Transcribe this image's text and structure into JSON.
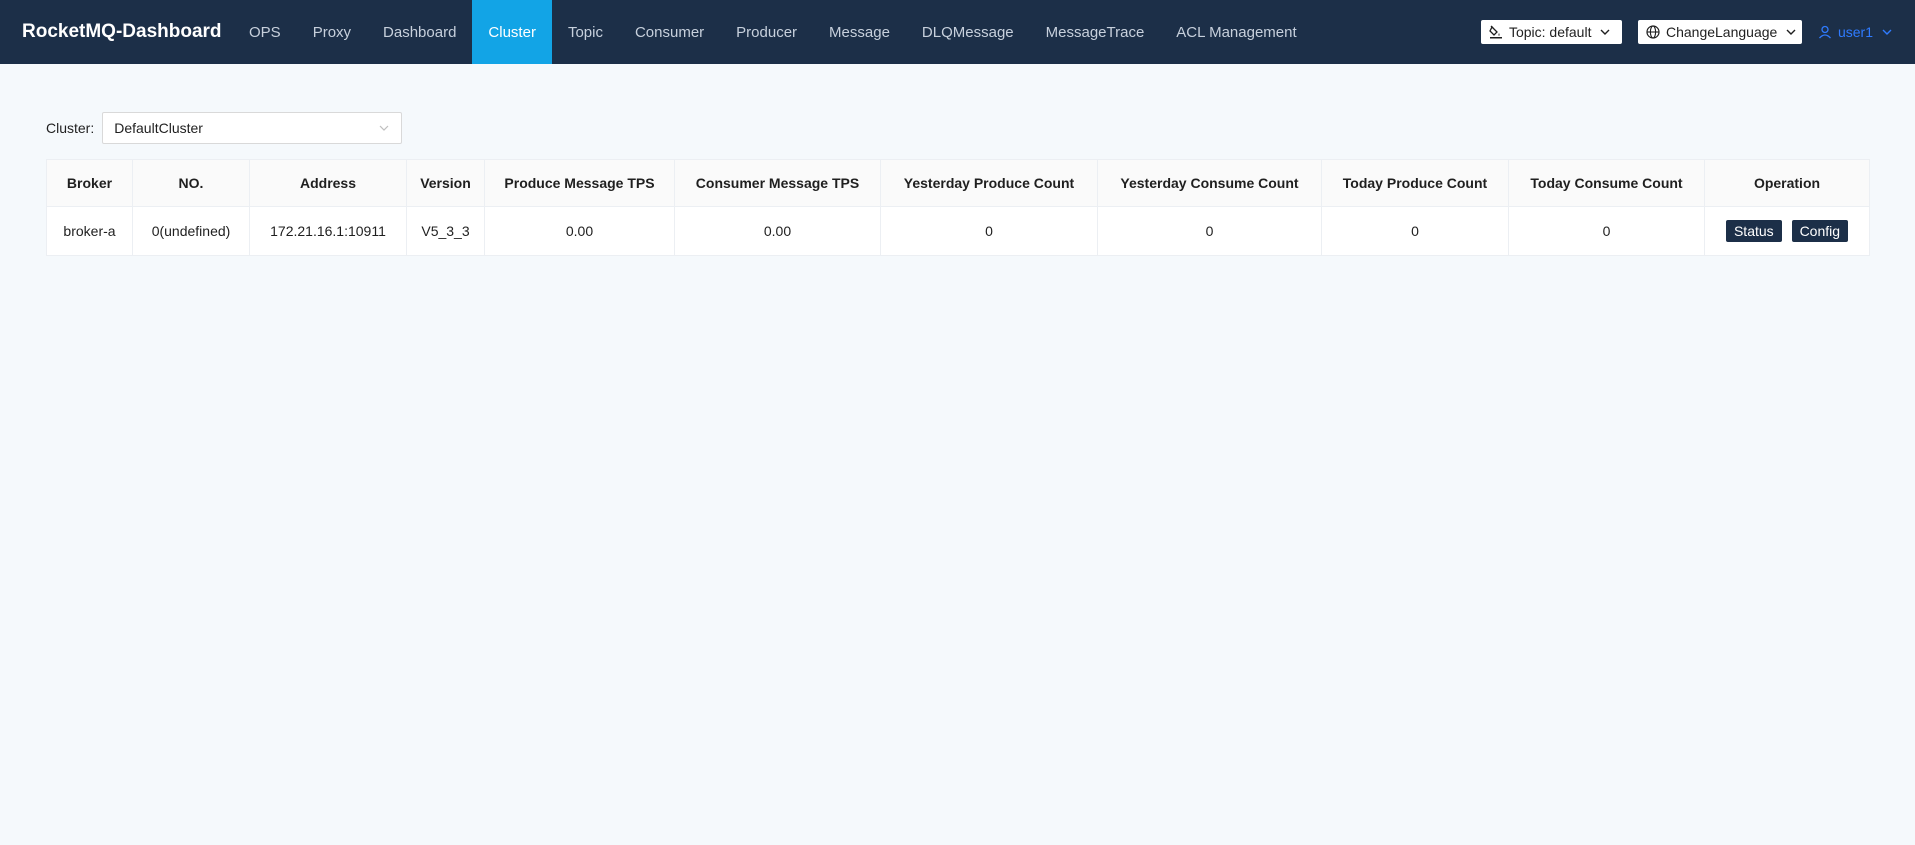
{
  "brand": "RocketMQ-Dashboard",
  "nav": [
    {
      "label": "OPS"
    },
    {
      "label": "Proxy"
    },
    {
      "label": "Dashboard"
    },
    {
      "label": "Cluster",
      "active": true
    },
    {
      "label": "Topic"
    },
    {
      "label": "Consumer"
    },
    {
      "label": "Producer"
    },
    {
      "label": "Message"
    },
    {
      "label": "DLQMessage"
    },
    {
      "label": "MessageTrace"
    },
    {
      "label": "ACL Management"
    }
  ],
  "toolbar": {
    "topic_label": "Topic: default",
    "topic_icon": "paint-bucket-icon",
    "language_label": "ChangeLanguage",
    "language_icon": "globe-icon",
    "user_label": "user1",
    "user_icon": "user-icon"
  },
  "filter": {
    "label": "Cluster:",
    "value": "DefaultCluster"
  },
  "table": {
    "headers": [
      "Broker",
      "NO.",
      "Address",
      "Version",
      "Produce Message TPS",
      "Consumer Message TPS",
      "Yesterday Produce Count",
      "Yesterday Consume Count",
      "Today Produce Count",
      "Today Consume Count",
      "Operation"
    ],
    "rows": [
      {
        "broker": "broker-a",
        "no": "0(undefined)",
        "address": "172.21.16.1:10911",
        "version": "V5_3_3",
        "produce_tps": "0.00",
        "consumer_tps": "0.00",
        "yesterday_produce": "0",
        "yesterday_consume": "0",
        "today_produce": "0",
        "today_consume": "0",
        "status_button": "Status",
        "config_button": "Config"
      }
    ]
  },
  "colors": {
    "header_bg": "#1c2f48",
    "active_tab": "#12a4e6",
    "page_bg": "#f5f9fc",
    "user_link": "#2f7bff"
  }
}
